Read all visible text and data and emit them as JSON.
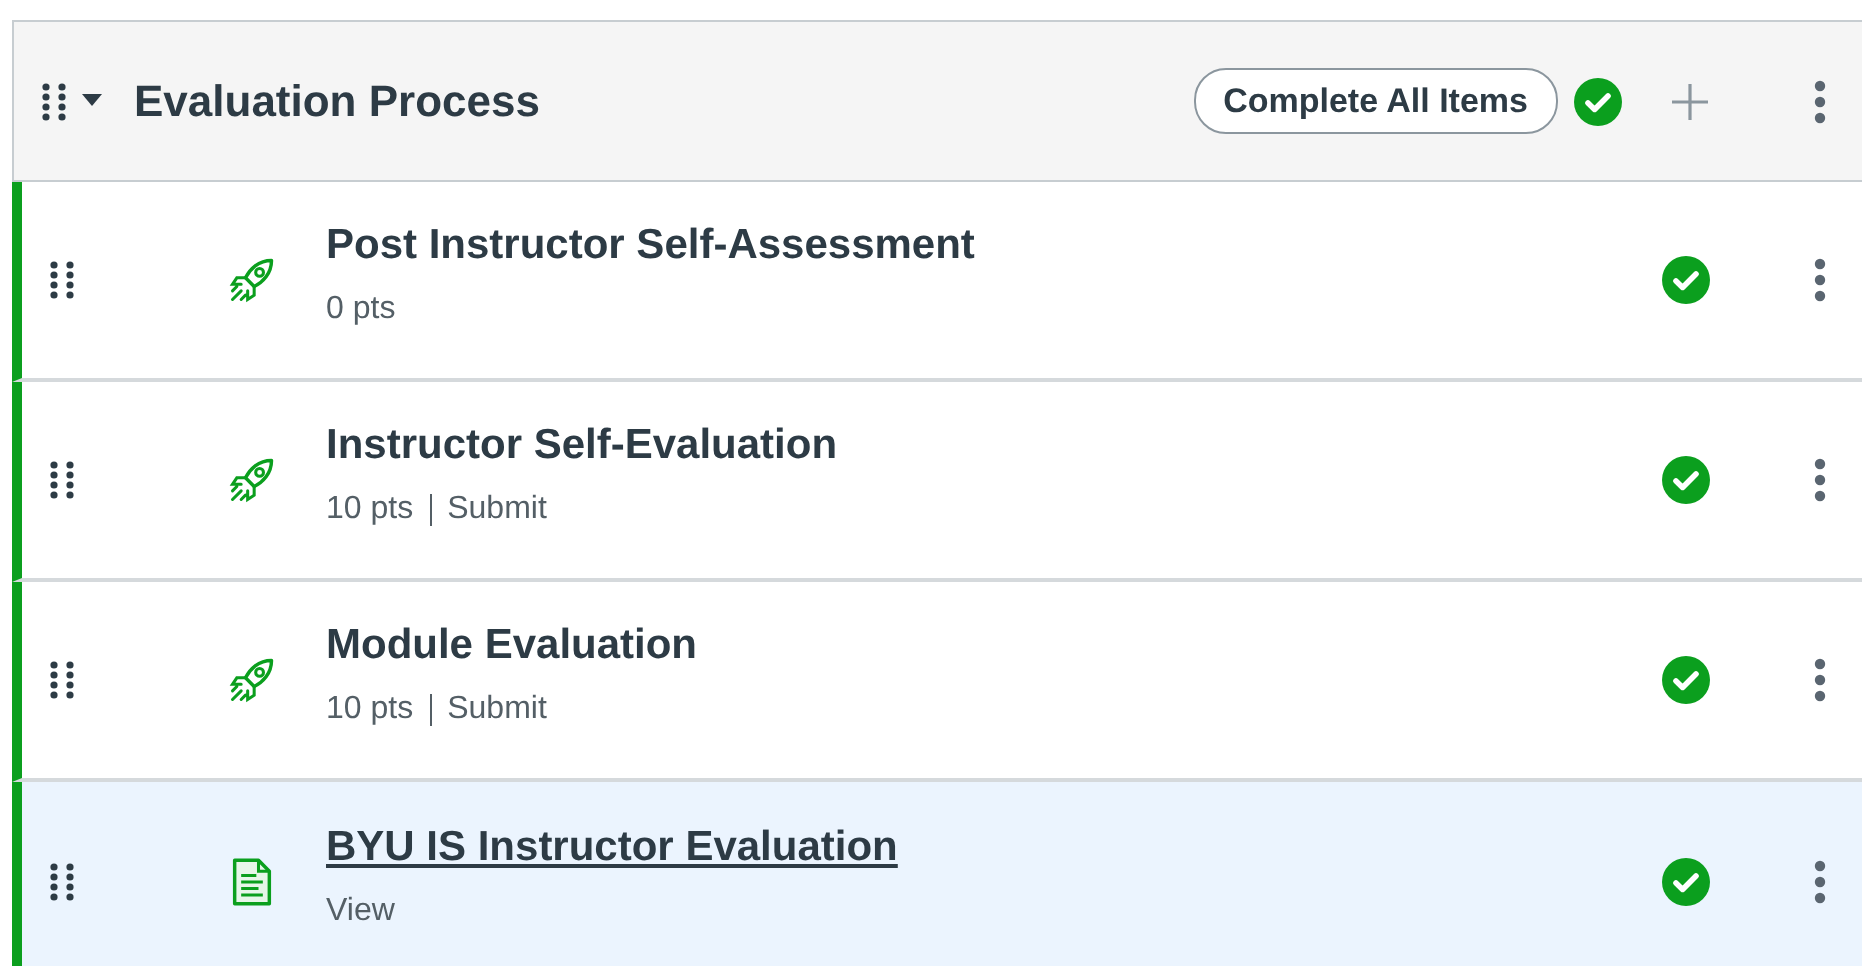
{
  "module": {
    "title": "Evaluation Process",
    "expanded": true,
    "requirement_button": "Complete All Items",
    "published": true
  },
  "items": [
    {
      "kind": "assignment",
      "title": "Post Instructor Self-Assessment",
      "points": "0 pts",
      "published": true,
      "selected": false
    },
    {
      "kind": "assignment",
      "title": "Instructor Self-Evaluation",
      "points": "10 pts",
      "action": "Submit",
      "published": true,
      "selected": false
    },
    {
      "kind": "assignment",
      "title": "Module Evaluation",
      "points": "10 pts",
      "action": "Submit",
      "published": true,
      "selected": false
    },
    {
      "kind": "page",
      "title": "BYU IS Instructor Evaluation",
      "action": "View",
      "published": true,
      "selected": true
    }
  ]
}
